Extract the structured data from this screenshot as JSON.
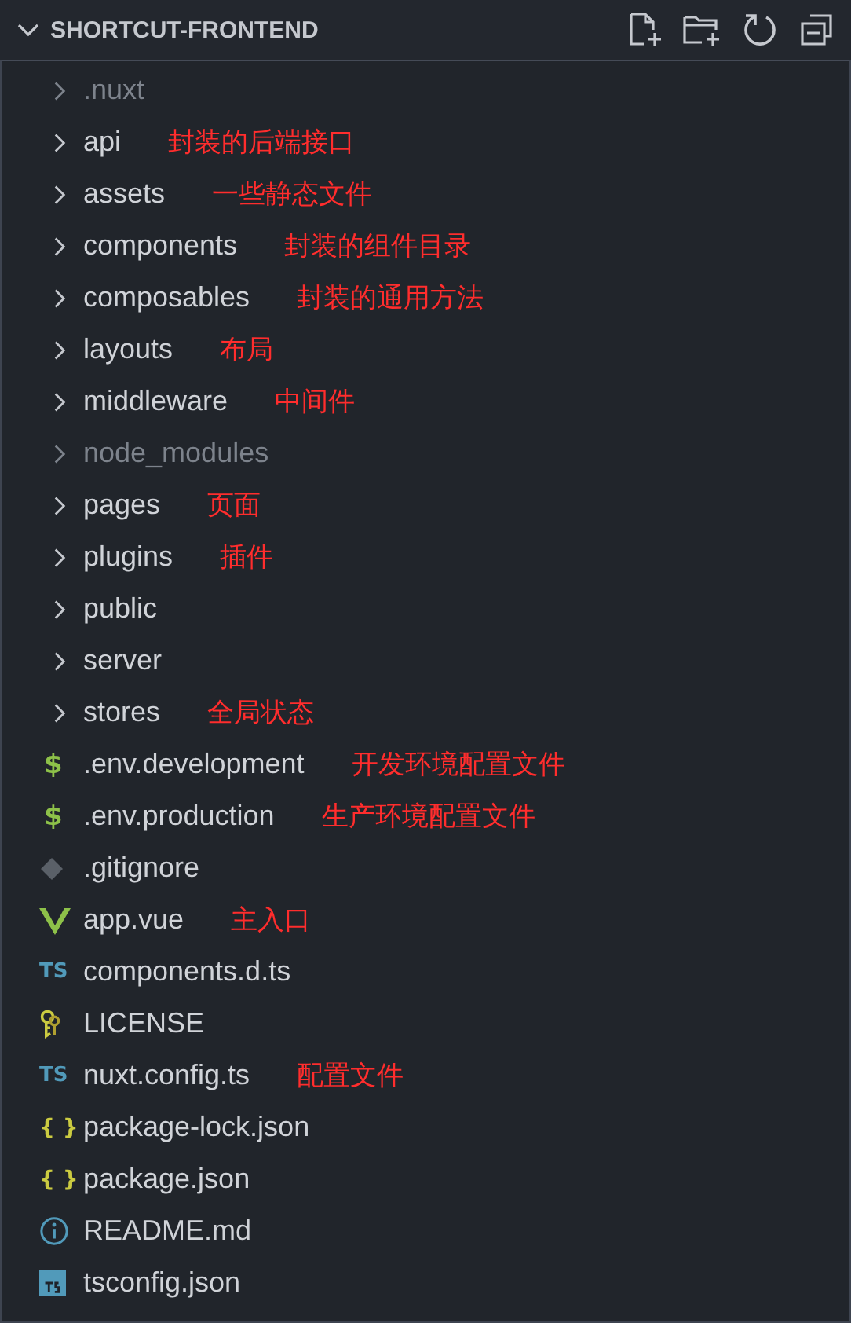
{
  "explorer": {
    "title": "SHORTCUT-FRONTEND",
    "expanded": true,
    "items": [
      {
        "kind": "folder",
        "name": ".nuxt",
        "dimmed": true
      },
      {
        "kind": "folder",
        "name": "api",
        "dimmed": false,
        "note": "封装的后端接口"
      },
      {
        "kind": "folder",
        "name": "assets",
        "dimmed": false,
        "note": "一些静态文件"
      },
      {
        "kind": "folder",
        "name": "components",
        "dimmed": false,
        "note": "封装的组件目录"
      },
      {
        "kind": "folder",
        "name": "composables",
        "dimmed": false,
        "note": "封装的通用方法"
      },
      {
        "kind": "folder",
        "name": "layouts",
        "dimmed": false,
        "note": "布局"
      },
      {
        "kind": "folder",
        "name": "middleware",
        "dimmed": false,
        "note": "中间件"
      },
      {
        "kind": "folder",
        "name": "node_modules",
        "dimmed": true
      },
      {
        "kind": "folder",
        "name": "pages",
        "dimmed": false,
        "note": "页面"
      },
      {
        "kind": "folder",
        "name": "plugins",
        "dimmed": false,
        "note": "插件"
      },
      {
        "kind": "folder",
        "name": "public",
        "dimmed": false
      },
      {
        "kind": "folder",
        "name": "server",
        "dimmed": false
      },
      {
        "kind": "folder",
        "name": "stores",
        "dimmed": false,
        "note": "全局状态"
      },
      {
        "kind": "env",
        "glyph": "$",
        "name": ".env.development",
        "dimmed": false,
        "note": "开发环境配置文件"
      },
      {
        "kind": "env",
        "glyph": "$",
        "name": ".env.production",
        "dimmed": false,
        "note": "生产环境配置文件"
      },
      {
        "kind": "git",
        "name": ".gitignore",
        "dimmed": false
      },
      {
        "kind": "vue",
        "name": "app.vue",
        "dimmed": false,
        "note": "主入口"
      },
      {
        "kind": "ts",
        "glyph": "TS",
        "name": "components.d.ts",
        "dimmed": false
      },
      {
        "kind": "license",
        "name": "LICENSE",
        "dimmed": false
      },
      {
        "kind": "ts",
        "glyph": "TS",
        "name": "nuxt.config.ts",
        "dimmed": false,
        "note": "配置文件"
      },
      {
        "kind": "json",
        "glyph": "{ }",
        "name": "package-lock.json",
        "dimmed": false
      },
      {
        "kind": "json",
        "glyph": "{ }",
        "name": "package.json",
        "dimmed": false
      },
      {
        "kind": "info",
        "name": "README.md",
        "dimmed": false
      },
      {
        "kind": "tsconfig",
        "name": "tsconfig.json",
        "dimmed": false
      }
    ]
  }
}
